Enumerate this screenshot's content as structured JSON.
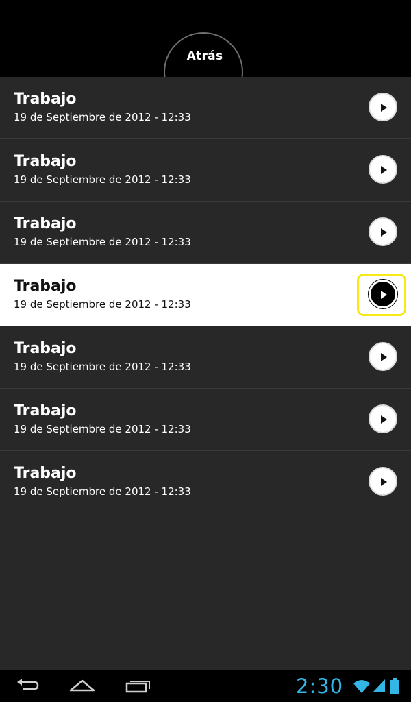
{
  "header": {
    "back_label": "Atrás"
  },
  "list": {
    "items": [
      {
        "title": "Trabajo",
        "subtitle": "19 de Septiembre de 2012 - 12:33"
      },
      {
        "title": "Trabajo",
        "subtitle": "19 de Septiembre de 2012 - 12:33"
      },
      {
        "title": "Trabajo",
        "subtitle": "19 de Septiembre de 2012 - 12:33"
      },
      {
        "title": "Trabajo",
        "subtitle": "19 de Septiembre de 2012 - 12:33"
      },
      {
        "title": "Trabajo",
        "subtitle": "19 de Septiembre de 2012 - 12:33"
      },
      {
        "title": "Trabajo",
        "subtitle": "19 de Septiembre de 2012 - 12:33"
      },
      {
        "title": "Trabajo",
        "subtitle": "19 de Septiembre de 2012 - 12:33"
      }
    ],
    "selected_index": 3,
    "play_icon": "play-icon"
  },
  "system_bar": {
    "clock": "2:30",
    "accent_color": "#33b5e5",
    "icons": [
      "back-icon",
      "home-icon",
      "recent-apps-icon",
      "wifi-icon",
      "signal-icon",
      "battery-icon"
    ]
  },
  "colors": {
    "list_background": "#282828",
    "selected_row": "#ffffff",
    "focus_highlight": "#f5ea16"
  }
}
